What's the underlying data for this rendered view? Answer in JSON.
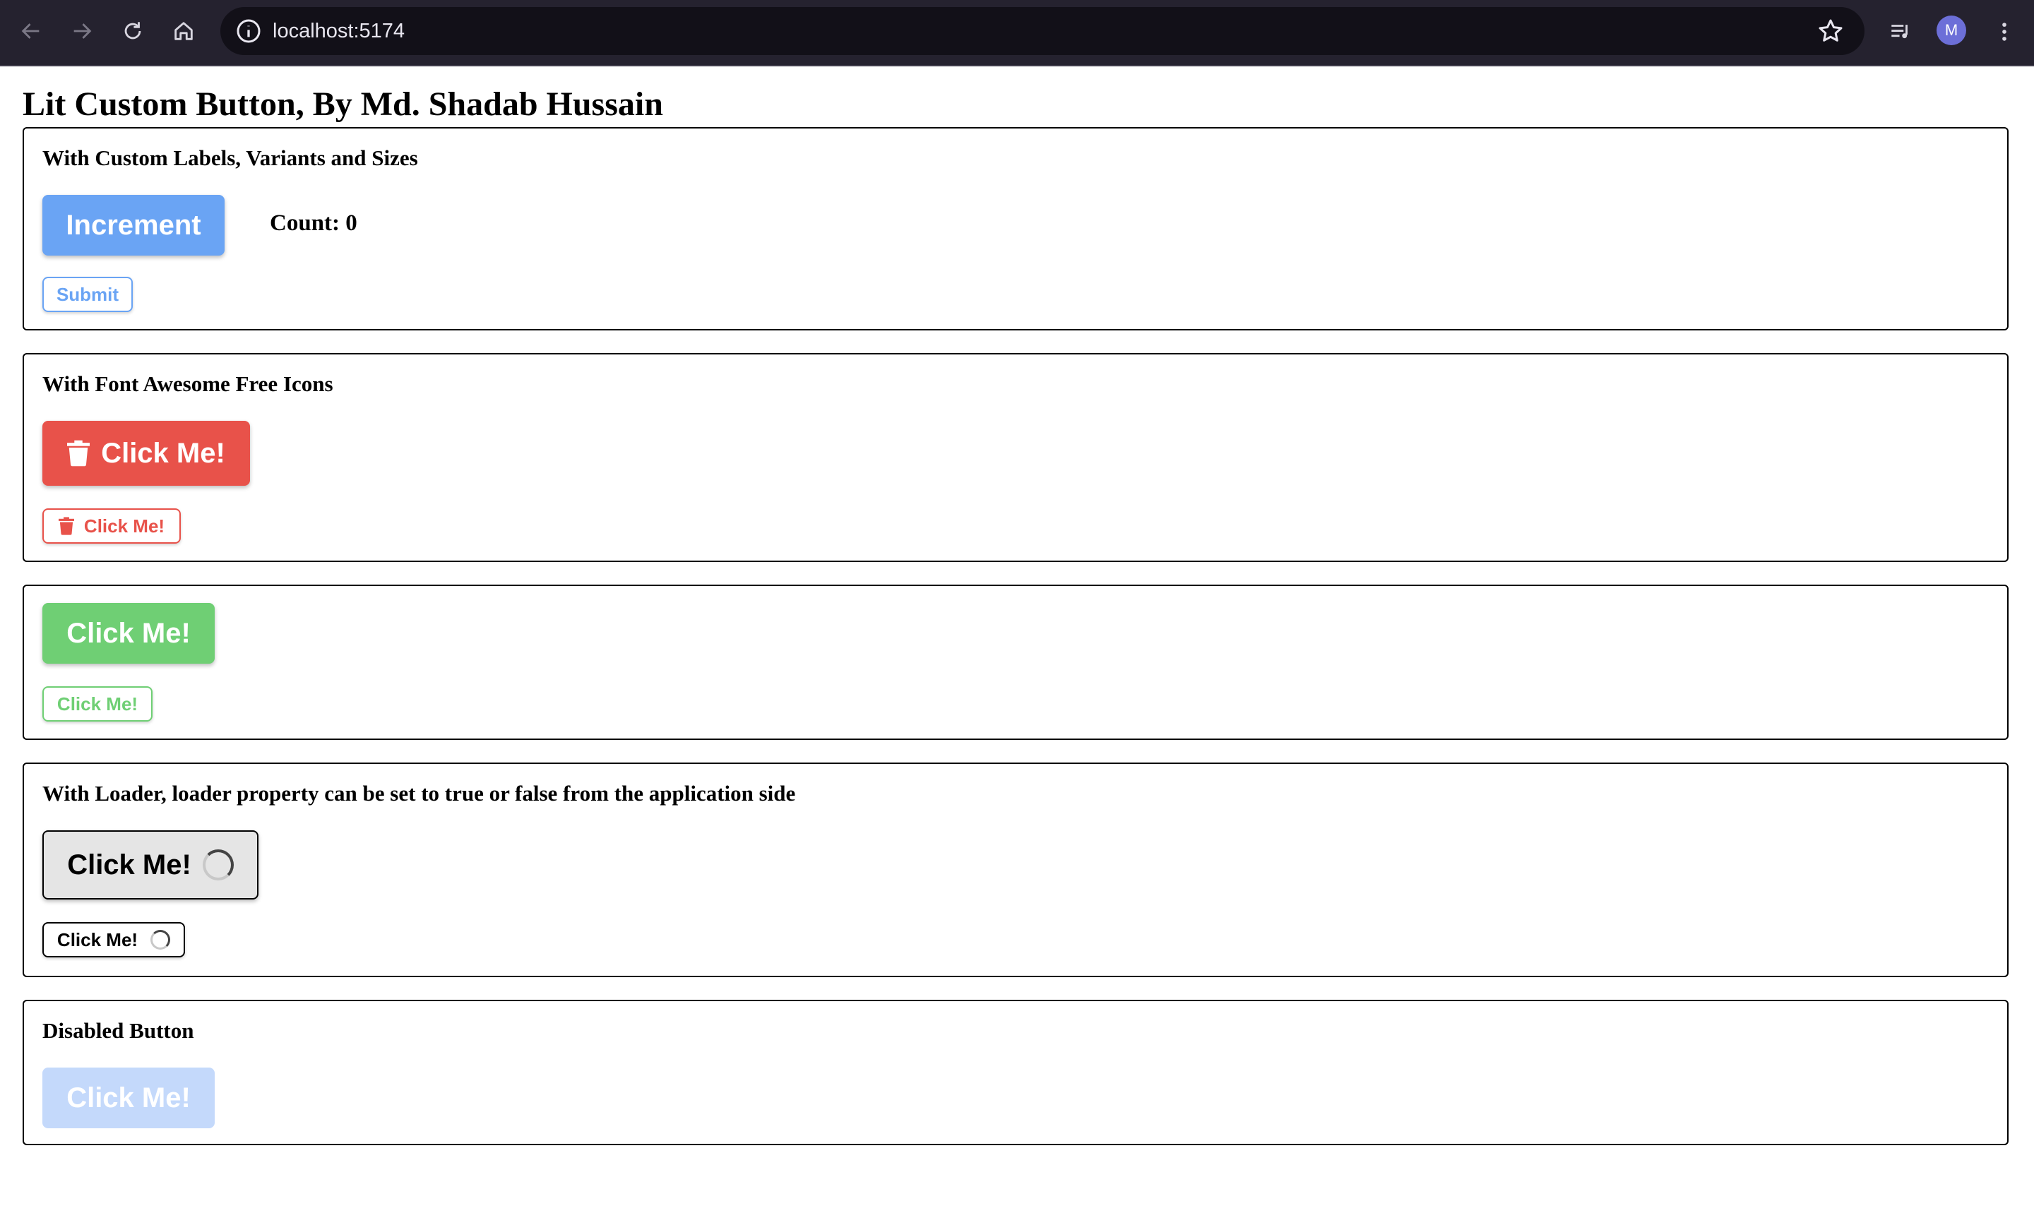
{
  "browser": {
    "url": "localhost:5174",
    "profile_initial": "M",
    "icons": [
      "back-arrow-icon",
      "forward-arrow-icon",
      "reload-icon",
      "home-icon",
      "site-info-icon",
      "bookmark-star-icon",
      "media-queue-icon",
      "more-vertical-icon"
    ]
  },
  "page": {
    "title": "Lit Custom Button, By Md. Shadab Hussain"
  },
  "sections": [
    {
      "title": "With Custom Labels, Variants and Sizes",
      "primary_button": "Increment",
      "count_text": "Count: 0",
      "outline_button": "Submit",
      "color": "#6aa4f4"
    },
    {
      "title": "With Font Awesome Free Icons",
      "primary_button": "Click Me!",
      "outline_button": "Click Me!",
      "icon": "trash-icon",
      "color": "#e8524a"
    },
    {
      "title": "",
      "primary_button": "Click Me!",
      "outline_button": "Click Me!",
      "color": "#6fcf74"
    },
    {
      "title": "With Loader, loader property can be set to true or false from the application side",
      "primary_button": "Click Me!",
      "outline_button": "Click Me!",
      "loader": true,
      "color": "#e5e5e5"
    },
    {
      "title": "Disabled Button",
      "primary_button": "Click Me!",
      "disabled": true,
      "color": "#c4d9fb"
    }
  ]
}
